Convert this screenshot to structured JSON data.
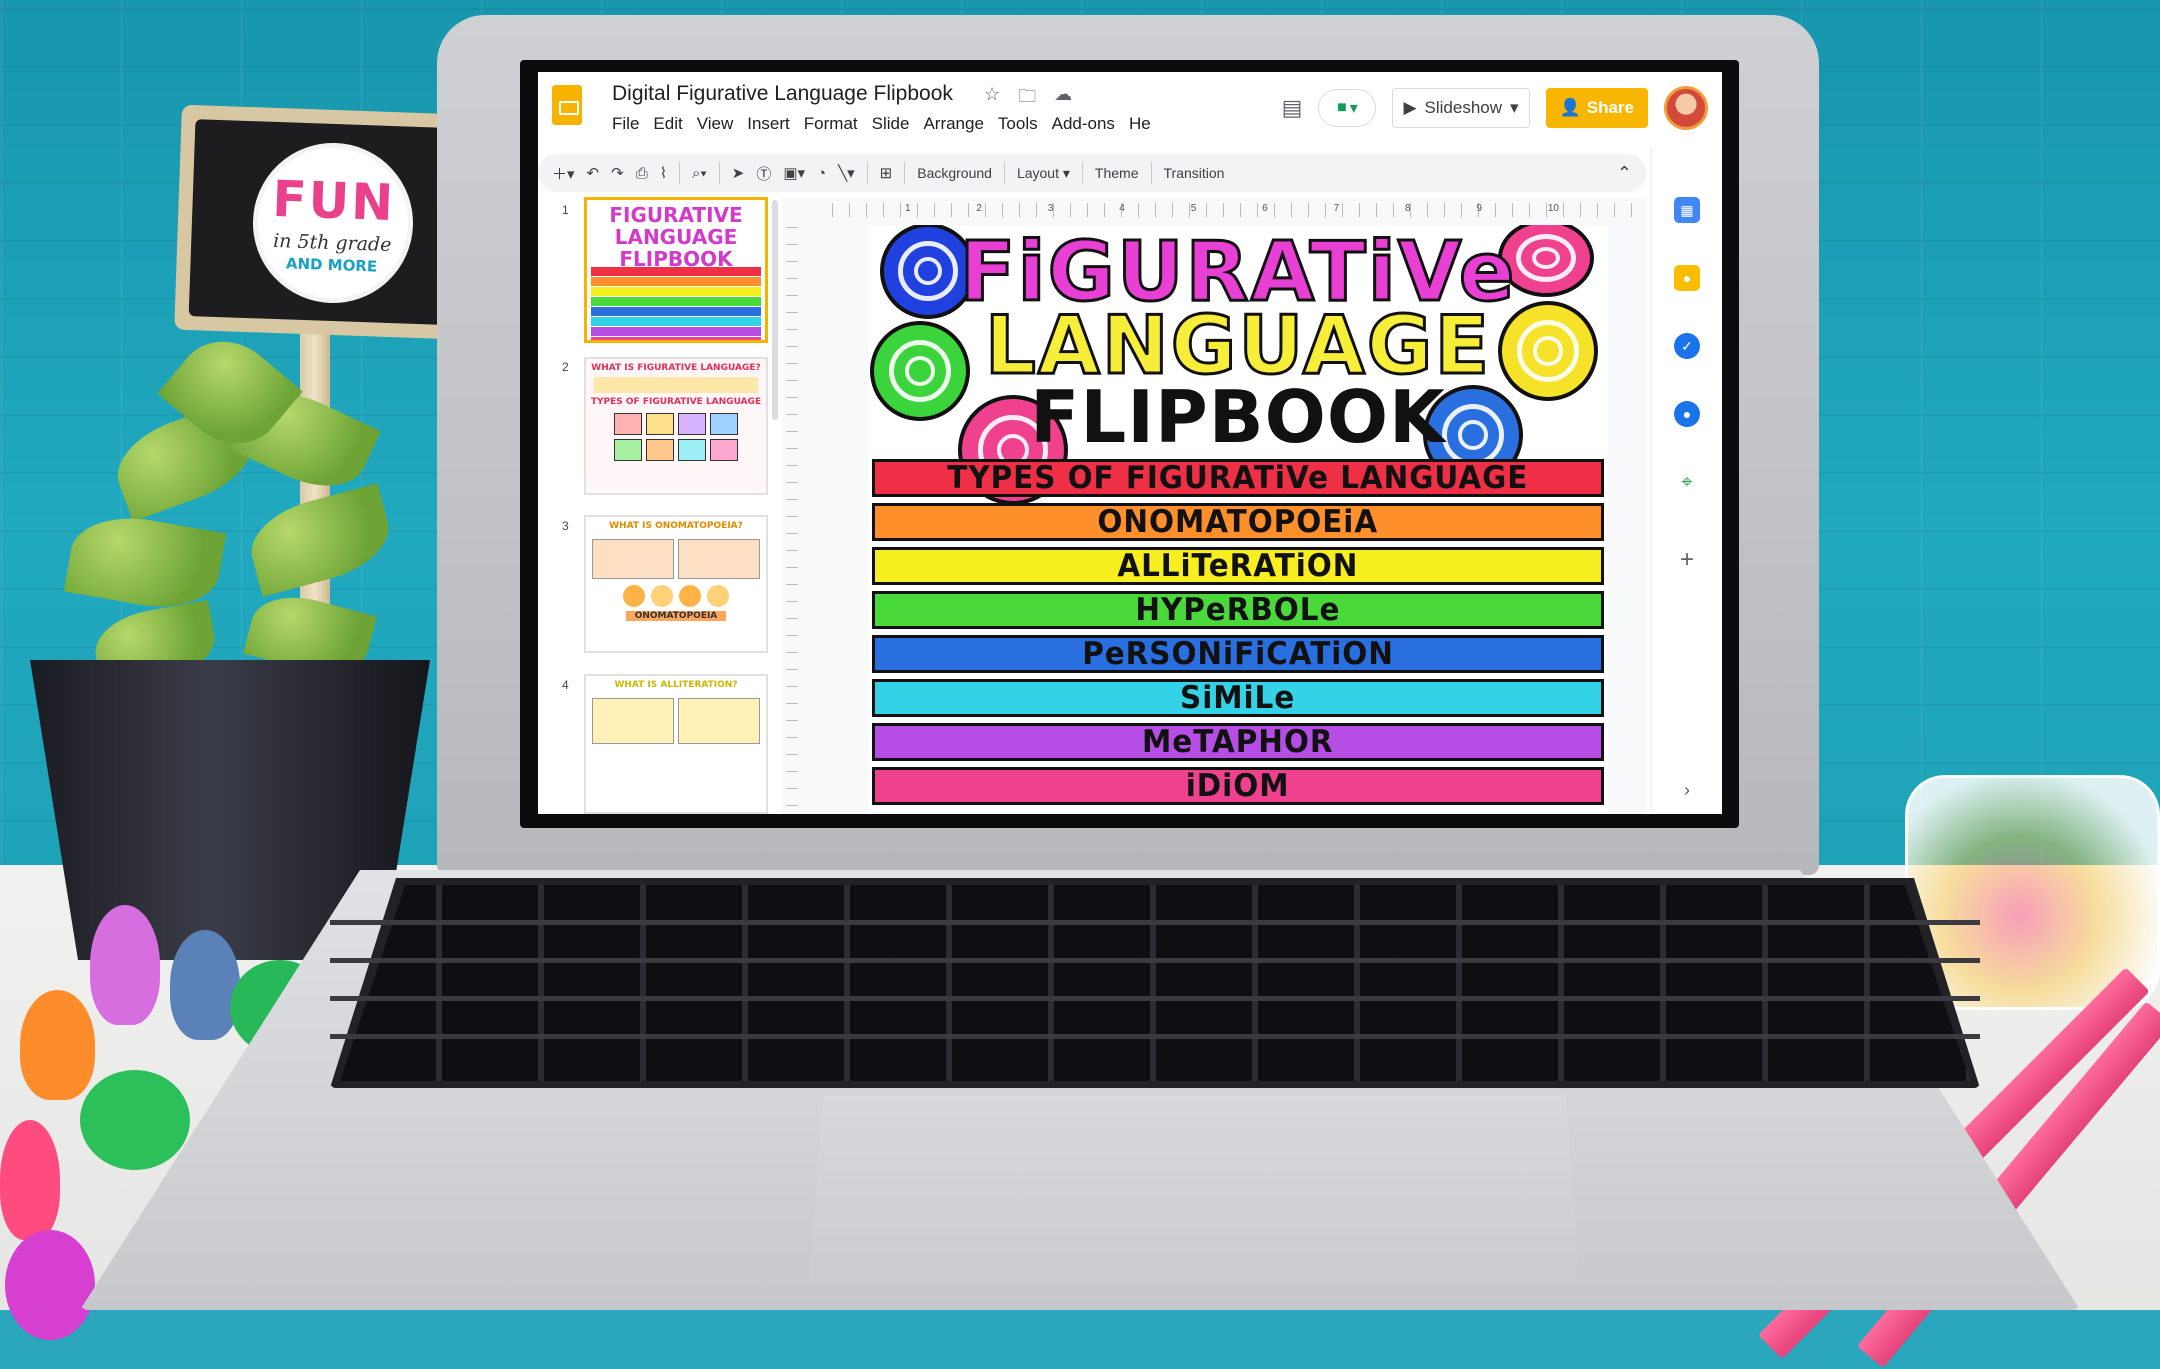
{
  "app": {
    "title": "Digital Figurative Language Flipbook",
    "menu": [
      "File",
      "Edit",
      "View",
      "Insert",
      "Format",
      "Slide",
      "Arrange",
      "Tools",
      "Add-ons",
      "He"
    ],
    "slideshow_label": "Slideshow",
    "share_label": "Share",
    "brand_color": "#f6b400"
  },
  "toolbar": {
    "background_label": "Background",
    "layout_label": "Layout",
    "theme_label": "Theme",
    "transition_label": "Transition"
  },
  "ruler": {
    "ticks": [
      "1",
      "2",
      "3",
      "4",
      "5",
      "6",
      "7",
      "8",
      "9",
      "10"
    ]
  },
  "filmstrip": {
    "slides": [
      {
        "num": "1",
        "heading": "FIGURATIVE LANGUAGE FLIPBOOK"
      },
      {
        "num": "2",
        "heading": "WHAT IS FIGURATIVE LANGUAGE?",
        "sub": "TYPES OF FIGURATIVE LANGUAGE"
      },
      {
        "num": "3",
        "heading": "WHAT IS ONOMATOPOEIA?",
        "sub": "ONOMATOPOEIA"
      },
      {
        "num": "4",
        "heading": "WHAT IS ALLITERATION?"
      }
    ]
  },
  "slide": {
    "title_line1": "FiGURATiVe",
    "title_line2": "LANGUAGE",
    "title_line3": "FLIPBOOK",
    "bands": [
      {
        "label": "TYPES OF FIGURATiVe LANGUAGE",
        "color": "#ef2f45"
      },
      {
        "label": "ONOMATOPOEiA",
        "color": "#ff8f2a"
      },
      {
        "label": "ALLiTeRATiON",
        "color": "#f7ef1f"
      },
      {
        "label": "HYPeRBOLe",
        "color": "#49d93a"
      },
      {
        "label": "PeRSONiFiCATiON",
        "color": "#2a6fe0"
      },
      {
        "label": "SiMiLe",
        "color": "#34d2e6"
      },
      {
        "label": "MeTAPHOR",
        "color": "#b64ee6"
      },
      {
        "label": "iDiOM",
        "color": "#f0418f"
      }
    ]
  },
  "sign": {
    "line1": "FUN",
    "line2": "in 5th grade",
    "line3": "AND MORE"
  }
}
